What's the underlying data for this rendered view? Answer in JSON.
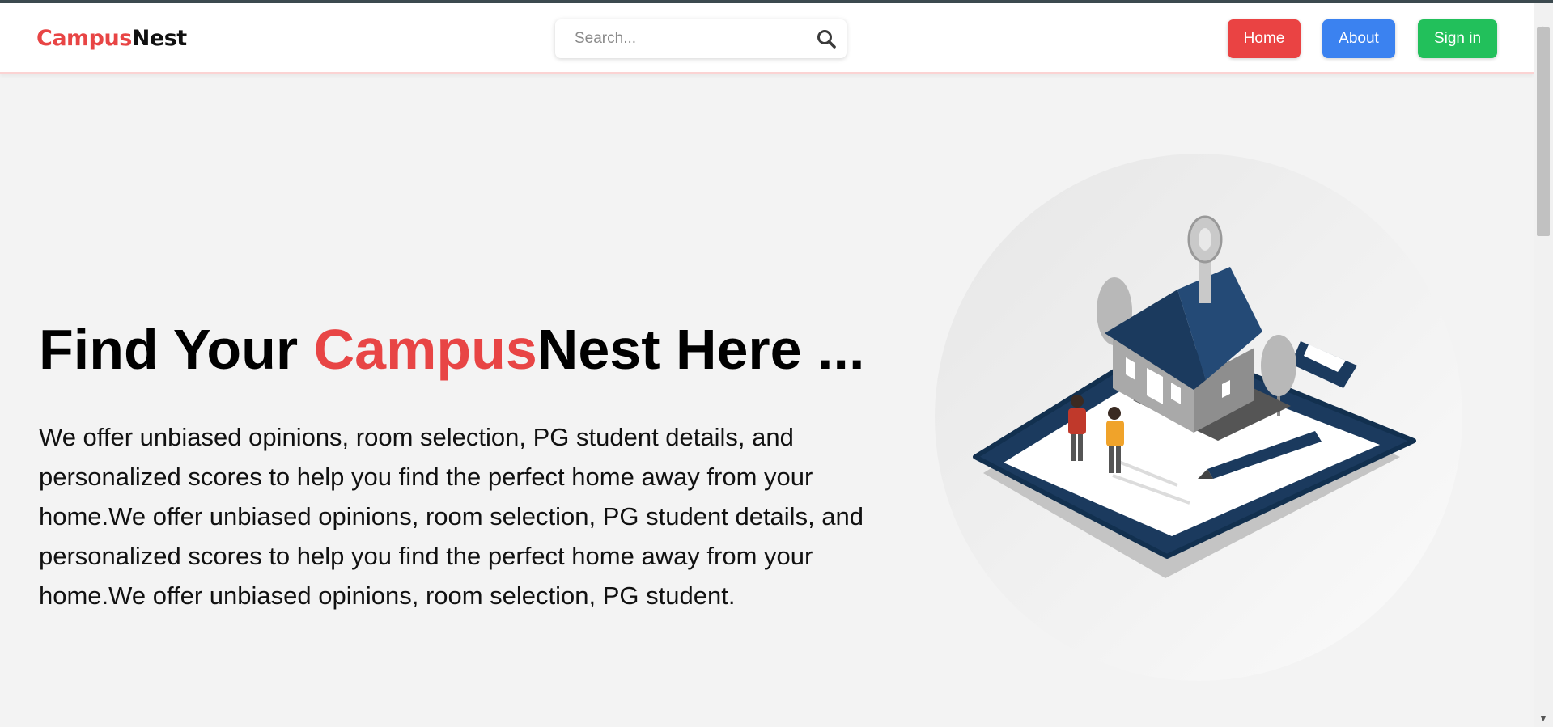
{
  "brand": {
    "part1": "Campus",
    "part2": "Nest"
  },
  "search": {
    "placeholder": "Search...",
    "icon": "search-icon"
  },
  "nav": {
    "home": "Home",
    "about": "About",
    "signin": "Sign in"
  },
  "hero": {
    "title_prefix": "Find Your ",
    "title_red": "Campus",
    "title_suffix": "Nest Here ...",
    "description": "We offer unbiased opinions, room selection, PG student details, and personalized scores to help you find the perfect home away from your home.We offer unbiased opinions, room selection, PG student details, and personalized scores to help you find the perfect home away from your home.We offer unbiased opinions, room selection, PG student."
  },
  "colors": {
    "brand_red": "#e84545",
    "home_button": "#ea4343",
    "about_button": "#3b82f0",
    "signin_button": "#22c05b"
  }
}
